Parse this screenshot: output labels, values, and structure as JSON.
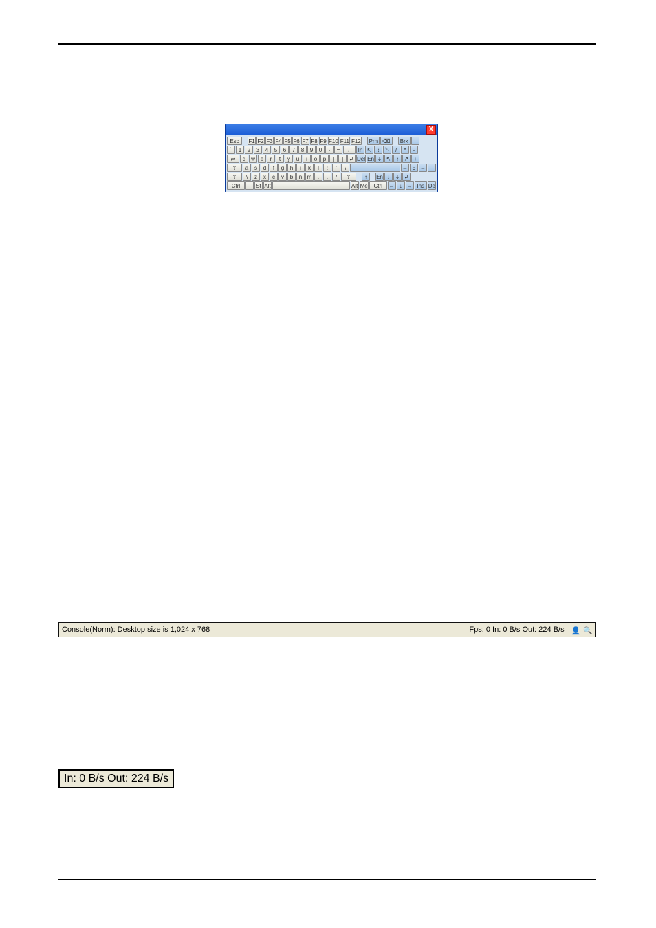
{
  "keyboard": {
    "close_label": "X",
    "row0": [
      "Esc",
      "",
      "F1",
      "F2",
      "F3",
      "F4",
      "F5",
      "F6",
      "F7",
      "F8",
      "F9",
      "F10",
      "F11",
      "F12",
      "",
      "Prn",
      "⌫",
      "",
      "Brk",
      ""
    ],
    "row1": [
      "`",
      "1",
      "2",
      "3",
      "4",
      "5",
      "6",
      "7",
      "8",
      "9",
      "0",
      "-",
      "=",
      "←",
      "In",
      "↖",
      "↕",
      "␡",
      "/",
      "*",
      "-"
    ],
    "row2": [
      "⇄",
      "q",
      "w",
      "e",
      "r",
      "t",
      "y",
      "u",
      "i",
      "o",
      "p",
      "[",
      "]",
      "↲",
      "Del",
      "En",
      "↧",
      "↖",
      "↑",
      "↗",
      "+"
    ],
    "row3": [
      "⇪",
      "a",
      "s",
      "d",
      "f",
      "g",
      "h",
      "j",
      "k",
      "l",
      ";",
      "'",
      "\\",
      "",
      "",
      "",
      "←",
      "5",
      "→",
      ""
    ],
    "row4": [
      "⇧",
      "\\",
      "z",
      "x",
      "c",
      "v",
      "b",
      "n",
      "m",
      ",",
      ".",
      "/",
      "",
      "⇧",
      "",
      "↑",
      "",
      "En",
      "↓",
      "↧",
      "↲"
    ],
    "row5": [
      "Ctrl",
      "",
      "St",
      "Alt",
      "",
      "Alt",
      "Me",
      "Ctrl",
      "←",
      "↓",
      "→",
      "Ins",
      "De"
    ]
  },
  "statusbar": {
    "left": "Console(Norm): Desktop size is 1,024 x 768",
    "right": "Fps: 0 In: 0 B/s Out: 224 B/s"
  },
  "netbox": {
    "text": "In: 0 B/s Out: 224 B/s"
  }
}
